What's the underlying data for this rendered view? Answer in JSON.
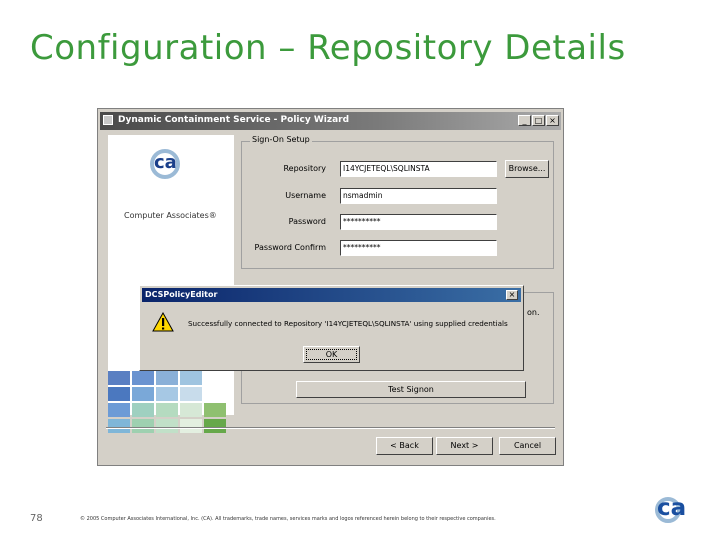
{
  "slide": {
    "title": "Configuration – Repository Details",
    "page_number": "78",
    "copyright": "© 2005 Computer Associates International, Inc. (CA). All trademarks, trade names, services marks and logos referenced herein belong to their respective companies.",
    "footer_logo_text": "ca"
  },
  "wizard": {
    "title": "Dynamic Containment Service - Policy Wizard",
    "window_buttons": {
      "minimize": "_",
      "maximize": "□",
      "close": "×"
    },
    "brand": {
      "logo_text": "ca",
      "company": "Computer Associates®"
    },
    "mosaic_colors": [
      "#5a7fc2",
      "#6a93d0",
      "#8ab0d8",
      "#9fc4e0",
      "#ffffff",
      "#4b78bf",
      "#7aa8d8",
      "#a6c8e4",
      "#c8dceb",
      "#ffffff",
      "#6c9bd6",
      "#9fd0c0",
      "#b5dbc0",
      "#d6e8d6",
      "#8fc070",
      "#7fb6d8",
      "#9ed0b0",
      "#c1e0c8",
      "#e3efe0",
      "#66a84a"
    ],
    "signon": {
      "group_label": "Sign-On Setup",
      "repository_label": "Repository",
      "repository_value": "I14YCJETEQL\\SQLINSTA",
      "browse_label": "Browse...",
      "username_label": "Username",
      "username_value": "nsmadmin",
      "password_label": "Password",
      "password_value": "**********",
      "password_confirm_label": "Password Confirm",
      "password_confirm_value": "**********"
    },
    "test_signon_label": "Test Signon",
    "side_text": "on.",
    "nav": {
      "back": "< Back",
      "next": "Next >",
      "cancel": "Cancel"
    }
  },
  "dialog": {
    "title": "DCSPolicyEditor",
    "close": "×",
    "message": "Successfully connected to Repository 'I14YCJETEQL\\SQLINSTA' using supplied credentials",
    "ok_label": "OK",
    "icon": "warning-icon"
  }
}
